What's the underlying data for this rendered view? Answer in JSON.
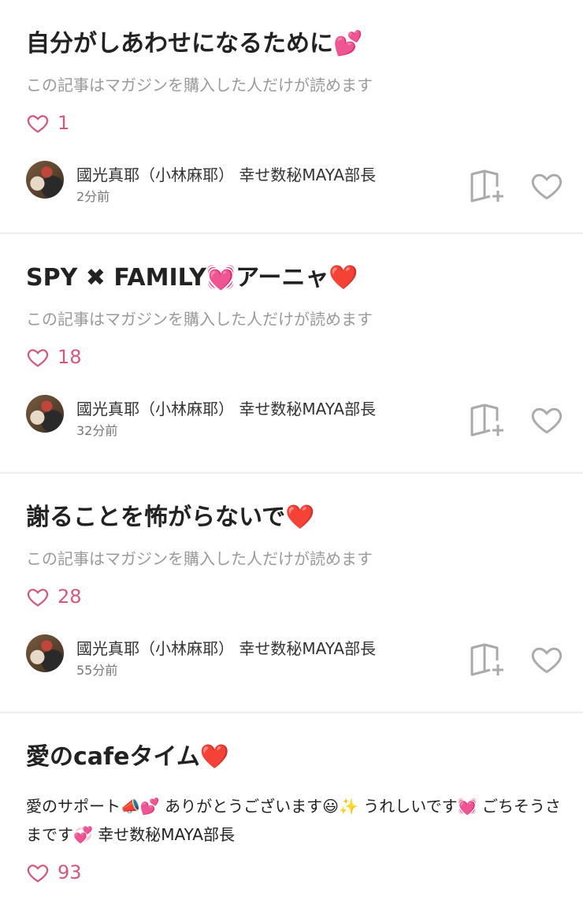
{
  "colors": {
    "like": "#d05a7a",
    "muted": "#9a9a9a",
    "divider": "#ececec",
    "icon": "#aaaaaa"
  },
  "icons": {
    "like": "heart-outline-icon",
    "magazine": "magazine-add-icon",
    "save": "heart-outline-icon"
  },
  "articles": [
    {
      "title": "自分がしあわせになるために💕",
      "paid_text": "この記事はマガジンを購入した人だけが読めます",
      "likes": "1",
      "author": "國光真耶（小林麻耶） 幸せ数秘MAYA部長",
      "time": "2分前"
    },
    {
      "title": "SPY ✖ FAMILY💓アーニャ❤️",
      "paid_text": "この記事はマガジンを購入した人だけが読めます",
      "likes": "18",
      "author": "國光真耶（小林麻耶） 幸せ数秘MAYA部長",
      "time": "32分前"
    },
    {
      "title": "謝ることを怖がらないで❤️",
      "paid_text": "この記事はマガジンを購入した人だけが読めます",
      "likes": "28",
      "author": "國光真耶（小林麻耶） 幸せ数秘MAYA部長",
      "time": "55分前"
    },
    {
      "title": "愛のcafeタイム❤️",
      "body": "愛のサポート📣💕 ありがとうございます😃✨ うれしいです💓 ごちそうさまです💞 幸せ数秘MAYA部長",
      "likes": "93"
    }
  ]
}
